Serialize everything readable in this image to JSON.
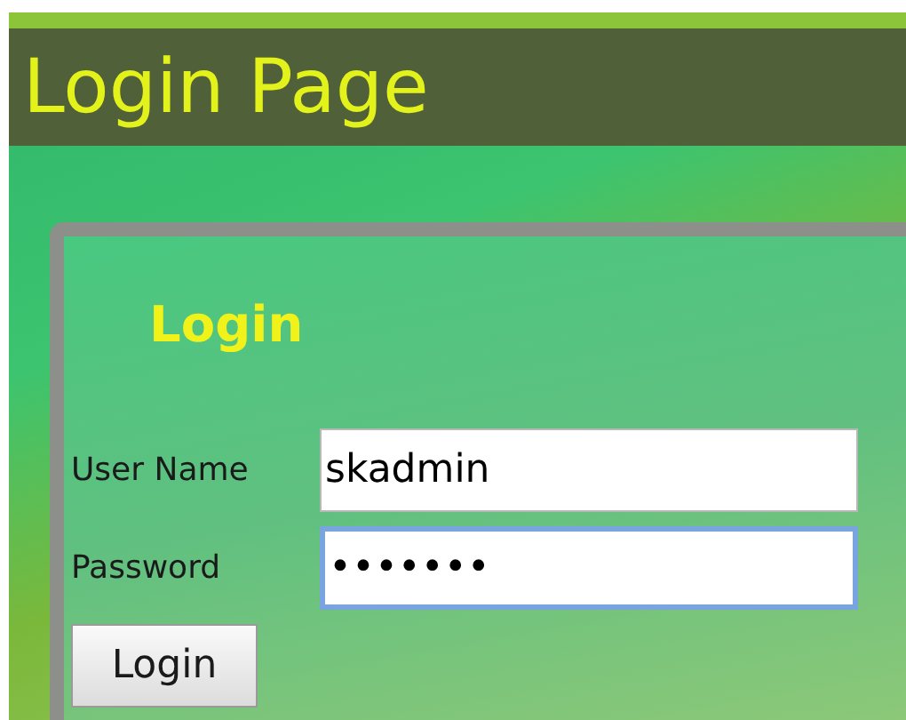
{
  "header": {
    "title": "Login Page"
  },
  "form": {
    "heading": "Login",
    "fields": [
      {
        "label": "User Name",
        "value": "skadmin",
        "focused": false
      },
      {
        "label": "Password",
        "value": "•••••••",
        "focused": true
      }
    ],
    "button": "Login"
  }
}
